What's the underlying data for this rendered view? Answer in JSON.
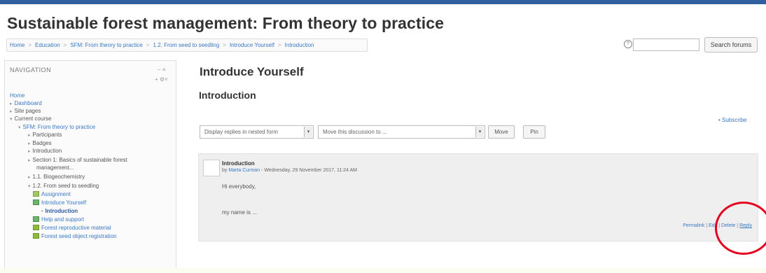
{
  "page": {
    "title": "Sustainable forest management: From theory to practice"
  },
  "breadcrumb": {
    "items": [
      "Home",
      "Education",
      "SFM: From theory to practice",
      "1.2. From seed to seedling",
      "Introduce Yourself",
      "Introduction"
    ],
    "separator": ">"
  },
  "search": {
    "help_icon": "?",
    "value": "",
    "button_label": "Search forums"
  },
  "navigation": {
    "header": "NAVIGATION",
    "controls": [
      "− ≡",
      "+ ⚙˅"
    ],
    "items": [
      {
        "label": "Home",
        "icon": ""
      },
      {
        "label": "Dashboard",
        "icon": "▸"
      },
      {
        "label": "Site pages",
        "icon": "▸"
      },
      {
        "label": "Current course",
        "icon": "▾"
      },
      {
        "label": "SFM: From theory to practice",
        "icon": "▾"
      },
      {
        "label": "Participants",
        "icon": "▸"
      },
      {
        "label": "Badges",
        "icon": "▸"
      },
      {
        "label": "Introduction",
        "icon": "▸"
      },
      {
        "label": "Section 1: Basics of sustainable forest",
        "icon": "▸"
      },
      {
        "label": "management...",
        "icon": ""
      },
      {
        "label": "1.1. Biogeochemistry",
        "icon": "▸"
      },
      {
        "label": "1.2. From seed to seedling",
        "icon": "▾"
      },
      {
        "label": "Assignment",
        "icon": "assignment-icon"
      },
      {
        "label": "Introduce Yourself",
        "icon": "forum-icon"
      },
      {
        "label": "Introduction",
        "icon": "•"
      },
      {
        "label": "Help and support",
        "icon": "forum-icon"
      },
      {
        "label": "Forest reproductive material",
        "icon": "folder-icon"
      },
      {
        "label": "Forest seed object registration",
        "icon": "folder-icon"
      }
    ]
  },
  "discussion": {
    "title": "Introduce Yourself",
    "heading": "Introduction",
    "subscribe": "• Subscribe",
    "display_mode": "Display replies in nested form",
    "move_select": "Move this discussion to ...",
    "move_button": "Move",
    "pin_button": "Pin"
  },
  "post": {
    "subject": "Introduction",
    "by": "by",
    "author": "Marta Curman",
    "date": " - Wednesday, 29 November 2017, 11:24 AM",
    "line1": "Hi everybody,",
    "line2": "my name is ...",
    "actions": {
      "permalink": "Permalink",
      "edit": "Edit",
      "delete": "Delete",
      "reply": "Reply"
    }
  },
  "colors": {
    "link": "#3a78c2",
    "annotation": "#e4001e",
    "top_bar": "#2f5f9f"
  }
}
